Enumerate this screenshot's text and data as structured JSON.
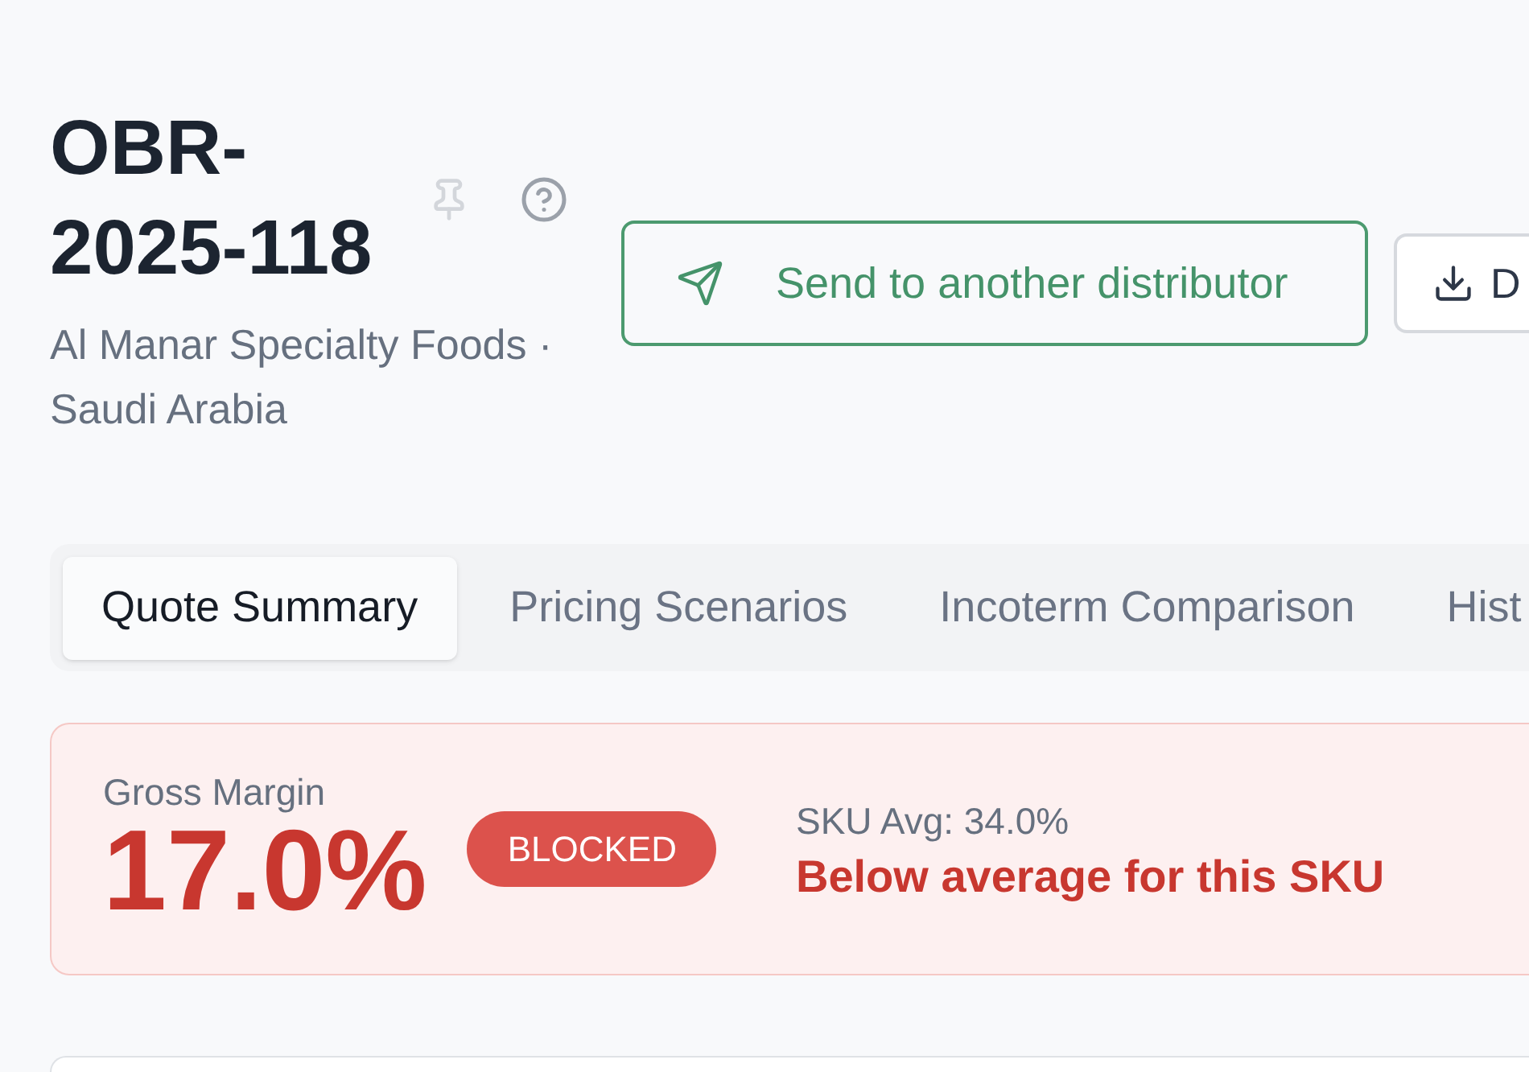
{
  "header": {
    "title": "OBR-2025-118",
    "subtitle": "Al Manar Specialty Foods · Saudi Arabia"
  },
  "actions": [
    {
      "kind": "send",
      "label": "Send to another distributor"
    },
    {
      "kind": "download",
      "label": "D"
    }
  ],
  "tabs": [
    {
      "label": "Quote Summary",
      "selected": true
    },
    {
      "label": "Pricing Scenarios",
      "selected": false
    },
    {
      "label": "Incoterm Comparison",
      "selected": false
    },
    {
      "label": "Hist",
      "selected": false
    }
  ],
  "margin_alert": {
    "label": "Gross Margin",
    "value": "17.0%",
    "status": "BLOCKED",
    "average": "SKU Avg: 34.0%",
    "message": "Below average for this SKU"
  }
}
